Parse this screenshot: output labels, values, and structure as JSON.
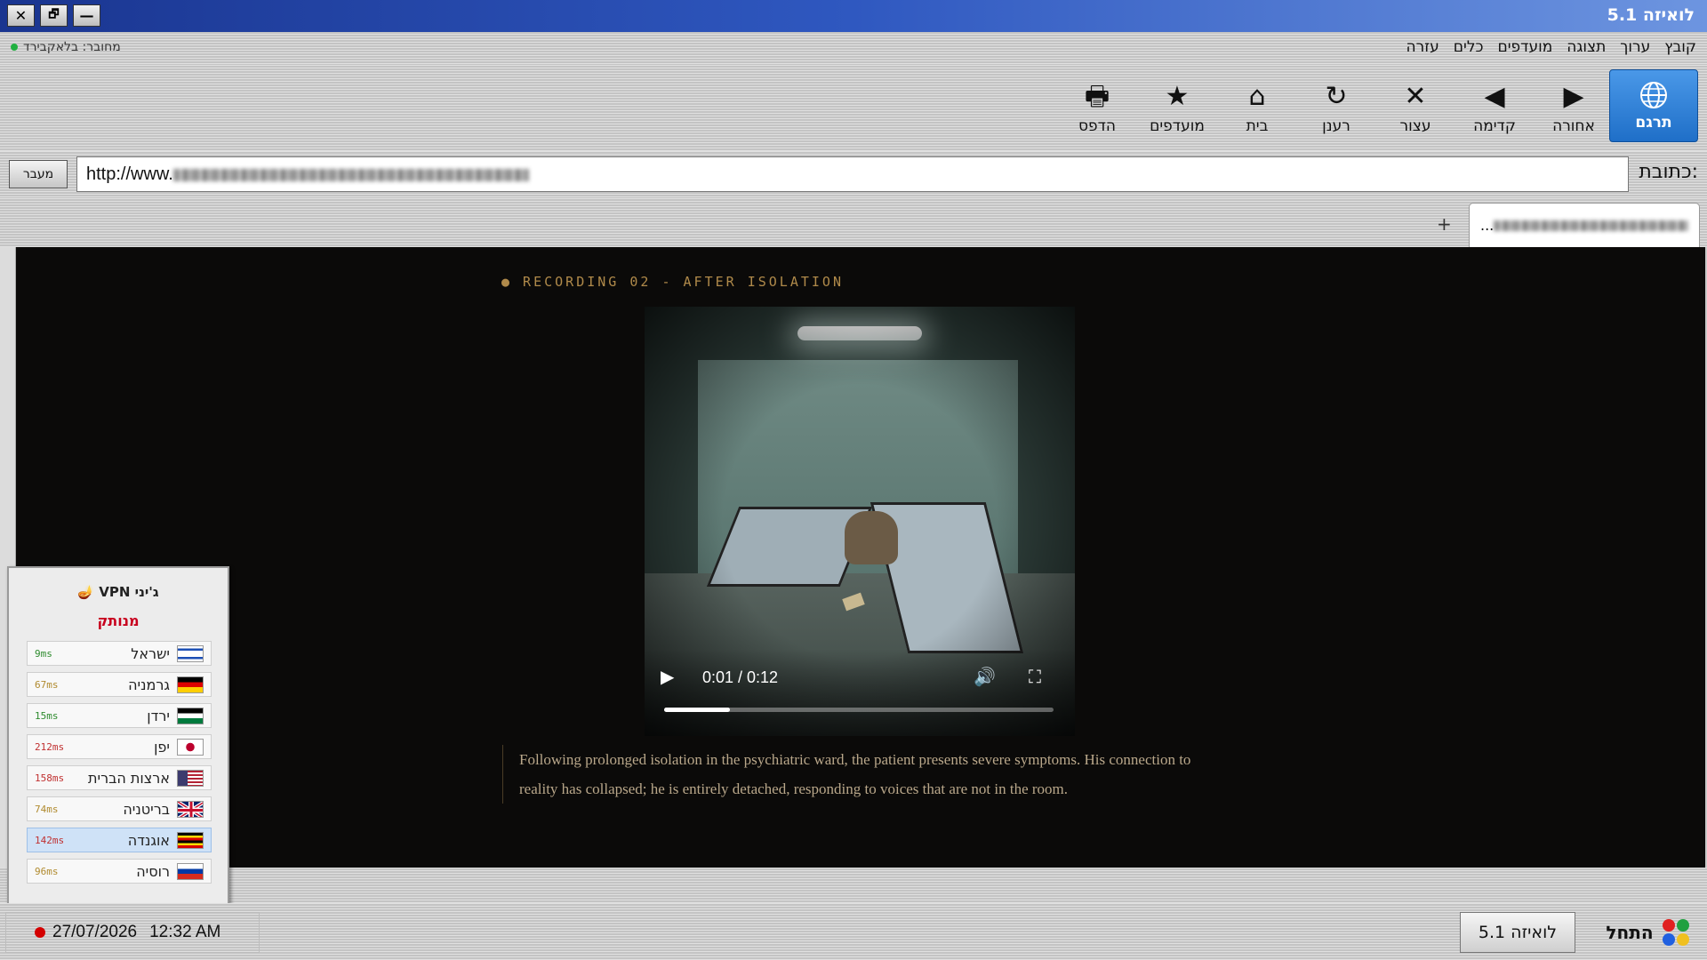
{
  "window": {
    "title": "לואיזה 5.1",
    "close": "✕",
    "maximize": "🗗",
    "minimize": "—"
  },
  "menu": [
    "קובץ",
    "ערוך",
    "תצוגה",
    "מועדפים",
    "כלים",
    "עזרה"
  ],
  "connection": "מחובר: בלאקבירד",
  "toolbar": {
    "translate": "תרגם",
    "back": "אחורה",
    "forward": "קדימה",
    "stop": "עצור",
    "refresh": "רענן",
    "home": "בית",
    "favorites": "מועדפים",
    "print": "הדפס"
  },
  "address": {
    "label": "כתובת:",
    "url_prefix": "http://www.",
    "go": "מעבר"
  },
  "tabs": {
    "tab1": "...",
    "new_tab": "+"
  },
  "page": {
    "recording_title": "● RECORDING 02 - AFTER ISOLATION",
    "video": {
      "current": "0:01",
      "duration": "0:12",
      "time_display": "0:01 / 0:12",
      "progress": 0.17
    },
    "caption": "Following prolonged isolation in the psychiatric ward, the patient presents severe symptoms. His connection to reality has collapsed; he is entirely detached, responding to voices that are not in the room."
  },
  "vpn": {
    "title": "ג'יני VPN",
    "status": "מנותק",
    "servers": [
      {
        "name": "ישראל",
        "latency": "9ms",
        "color": "#2e8b2e",
        "flag": "il"
      },
      {
        "name": "גרמניה",
        "latency": "67ms",
        "color": "#b08a2e",
        "flag": "de"
      },
      {
        "name": "ירדן",
        "latency": "15ms",
        "color": "#2e8b2e",
        "flag": "jo"
      },
      {
        "name": "יפן",
        "latency": "212ms",
        "color": "#c03030",
        "flag": "jp"
      },
      {
        "name": "ארצות הברית",
        "latency": "158ms",
        "color": "#c03030",
        "flag": "us"
      },
      {
        "name": "בריטניה",
        "latency": "74ms",
        "color": "#b08a2e",
        "flag": "gb"
      },
      {
        "name": "אוגנדה",
        "latency": "142ms",
        "color": "#c03030",
        "flag": "ug",
        "selected": true
      },
      {
        "name": "רוסיה",
        "latency": "96ms",
        "color": "#b08a2e",
        "flag": "ru"
      }
    ]
  },
  "taskbar": {
    "start": "התחל",
    "app": "לואיזה 5.1",
    "date": "27/07/2026",
    "time": "12:32 AM"
  }
}
